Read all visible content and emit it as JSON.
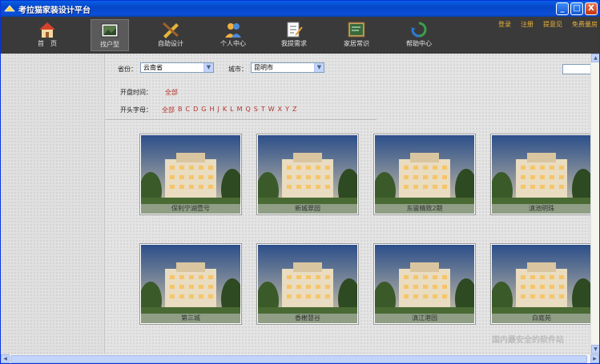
{
  "window": {
    "title": "考拉猫家装设计平台",
    "minimize": "_",
    "maximize": "□",
    "close": "X"
  },
  "nav": [
    {
      "label": "首　页",
      "icon": "home-icon"
    },
    {
      "label": "找户型",
      "icon": "floorplan-icon"
    },
    {
      "label": "自助设计",
      "icon": "design-tools-icon"
    },
    {
      "label": "个人中心",
      "icon": "user-icon"
    },
    {
      "label": "我提需求",
      "icon": "request-icon"
    },
    {
      "label": "家居常识",
      "icon": "board-icon"
    },
    {
      "label": "帮助中心",
      "icon": "help-icon"
    }
  ],
  "top_links": [
    "登录",
    "注册",
    "提意见",
    "免费量房"
  ],
  "filters": {
    "province_label": "省份：",
    "province_value": "云南省",
    "city_label": "城市：",
    "city_value": "昆明市",
    "open_time_label": "开盘时间：",
    "open_time_value": "全部",
    "initial_label": "开头字母：",
    "initial_all": "全部",
    "letters": [
      "B",
      "C",
      "D",
      "G",
      "H",
      "J",
      "K",
      "L",
      "M",
      "Q",
      "S",
      "T",
      "W",
      "X",
      "Y",
      "Z"
    ]
  },
  "listings": [
    {
      "name": "保利宁湖壹号"
    },
    {
      "name": "新城翠园"
    },
    {
      "name": "东骏精致2期"
    },
    {
      "name": "滇池明珠"
    },
    {
      "name": "第三城"
    },
    {
      "name": "香榭慧谷"
    },
    {
      "name": "滇江港园"
    },
    {
      "name": "白庭苑"
    }
  ],
  "watermark": "国内最安全的软件站",
  "colors": {
    "nav_bg": "#3a3a3a",
    "link": "#e8b23a",
    "accent_red": "#b5302a"
  }
}
